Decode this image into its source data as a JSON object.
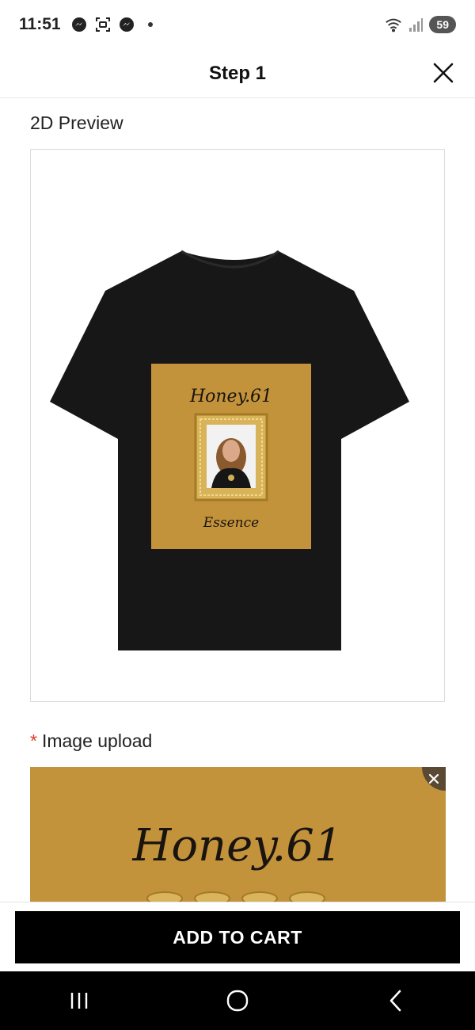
{
  "status_bar": {
    "time": "11:51",
    "battery": "59",
    "notification_icons": [
      "messenger-icon",
      "screenshot-icon",
      "messenger-icon",
      "dot-icon"
    ],
    "signal_icons": [
      "wifi-icon",
      "signal-icon"
    ]
  },
  "header": {
    "title": "Step 1",
    "close_icon": "close-icon"
  },
  "preview": {
    "label": "2D Preview",
    "product": "black t-shirt",
    "print_title": "Honey.61",
    "print_subtitle": "Essence",
    "print_background": "#c3933c"
  },
  "upload": {
    "label": "Image upload",
    "required_mark": "*",
    "image_title": "Honey.61",
    "remove_icon": "close-icon"
  },
  "actions": {
    "add_to_cart": "ADD TO CART"
  },
  "nav_bar": {
    "buttons": [
      "recent-apps-icon",
      "home-icon",
      "back-icon"
    ]
  },
  "colors": {
    "accent": "#000000",
    "required": "#e03b2f",
    "gold": "#c3933c",
    "shirt": "#171717"
  }
}
